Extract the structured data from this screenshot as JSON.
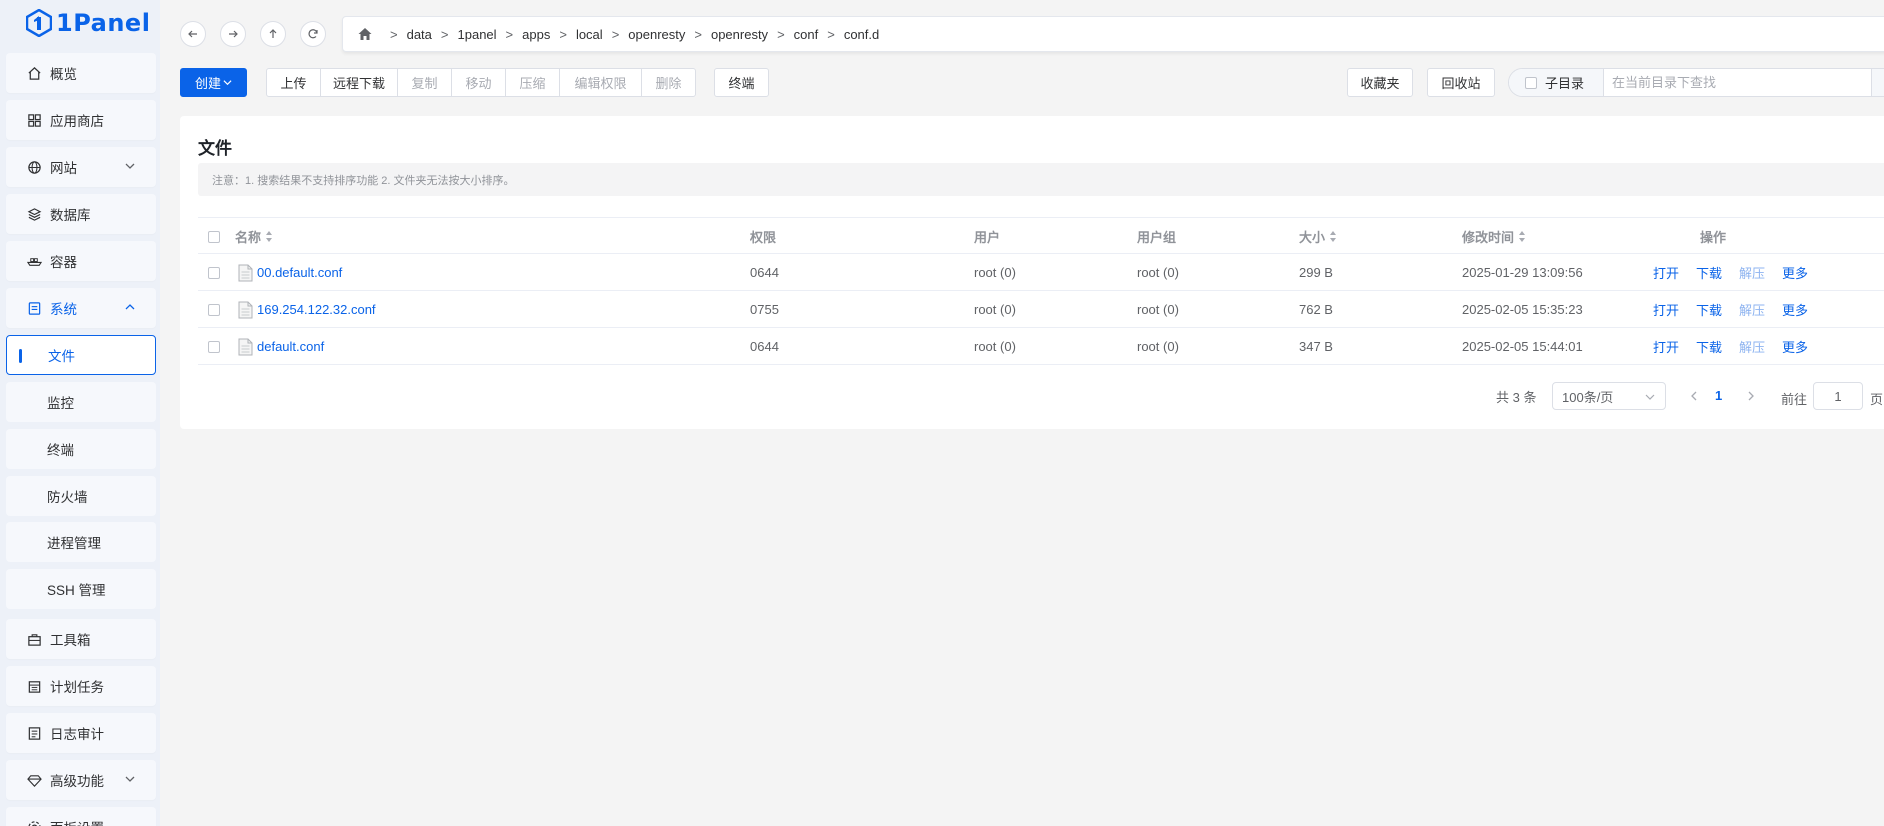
{
  "app": {
    "name": "1Panel"
  },
  "sidebar": {
    "items": [
      {
        "label": "概览",
        "icon": "home-icon"
      },
      {
        "label": "应用商店",
        "icon": "grid-icon"
      },
      {
        "label": "网站",
        "icon": "globe-icon",
        "expandable": true
      },
      {
        "label": "数据库",
        "icon": "layers-icon"
      },
      {
        "label": "容器",
        "icon": "container-icon"
      },
      {
        "label": "系统",
        "icon": "system-icon",
        "expanded": true
      },
      {
        "label": "工具箱",
        "icon": "toolbox-icon"
      },
      {
        "label": "计划任务",
        "icon": "calendar-icon"
      },
      {
        "label": "日志审计",
        "icon": "log-icon"
      },
      {
        "label": "高级功能",
        "icon": "diamond-icon",
        "expandable": true
      },
      {
        "label": "面板设置",
        "icon": "settings-icon"
      }
    ],
    "system_children": [
      {
        "label": "文件",
        "active": true
      },
      {
        "label": "监控"
      },
      {
        "label": "终端"
      },
      {
        "label": "防火墙"
      },
      {
        "label": "进程管理"
      },
      {
        "label": "SSH 管理"
      }
    ]
  },
  "breadcrumb": [
    "data",
    "1panel",
    "apps",
    "local",
    "openresty",
    "openresty",
    "conf",
    "conf.d"
  ],
  "breadcrumb_sep": ">",
  "toolbar": {
    "create": "创建",
    "upload": "上传",
    "remote_download": "远程下载",
    "copy": "复制",
    "move": "移动",
    "compress": "压缩",
    "edit_permission": "编辑权限",
    "delete": "删除",
    "terminal": "终端",
    "favorites": "收藏夹",
    "recycle_bin": "回收站",
    "subdir": "子目录",
    "search_placeholder": "在当前目录下查找"
  },
  "card": {
    "title": "文件",
    "notice": "注意：1. 搜索结果不支持排序功能 2. 文件夹无法按大小排序。"
  },
  "table": {
    "headers": {
      "name": "名称",
      "permission": "权限",
      "user": "用户",
      "group": "用户组",
      "size": "大小",
      "modified": "修改时间",
      "actions": "操作"
    },
    "rows": [
      {
        "name": "00.default.conf",
        "permission": "0644",
        "user": "root (0)",
        "group": "root (0)",
        "size": "299 B",
        "modified": "2025-01-29 13:09:56"
      },
      {
        "name": "169.254.122.32.conf",
        "permission": "0755",
        "user": "root (0)",
        "group": "root (0)",
        "size": "762 B",
        "modified": "2025-02-05 15:35:23"
      },
      {
        "name": "default.conf",
        "permission": "0644",
        "user": "root (0)",
        "group": "root (0)",
        "size": "347 B",
        "modified": "2025-02-05 15:44:01"
      }
    ],
    "row_actions": {
      "open": "打开",
      "download": "下载",
      "decompress": "解压",
      "more": "更多"
    }
  },
  "pagination": {
    "total": "共 3 条",
    "page_size": "100条/页",
    "current_page": "1",
    "goto_label": "前往",
    "goto_value": "1",
    "page_suffix": "页"
  },
  "colors": {
    "primary": "#0a63e8",
    "sidebar_bg": "#edf1f8",
    "page_bg": "#f4f4f4"
  }
}
